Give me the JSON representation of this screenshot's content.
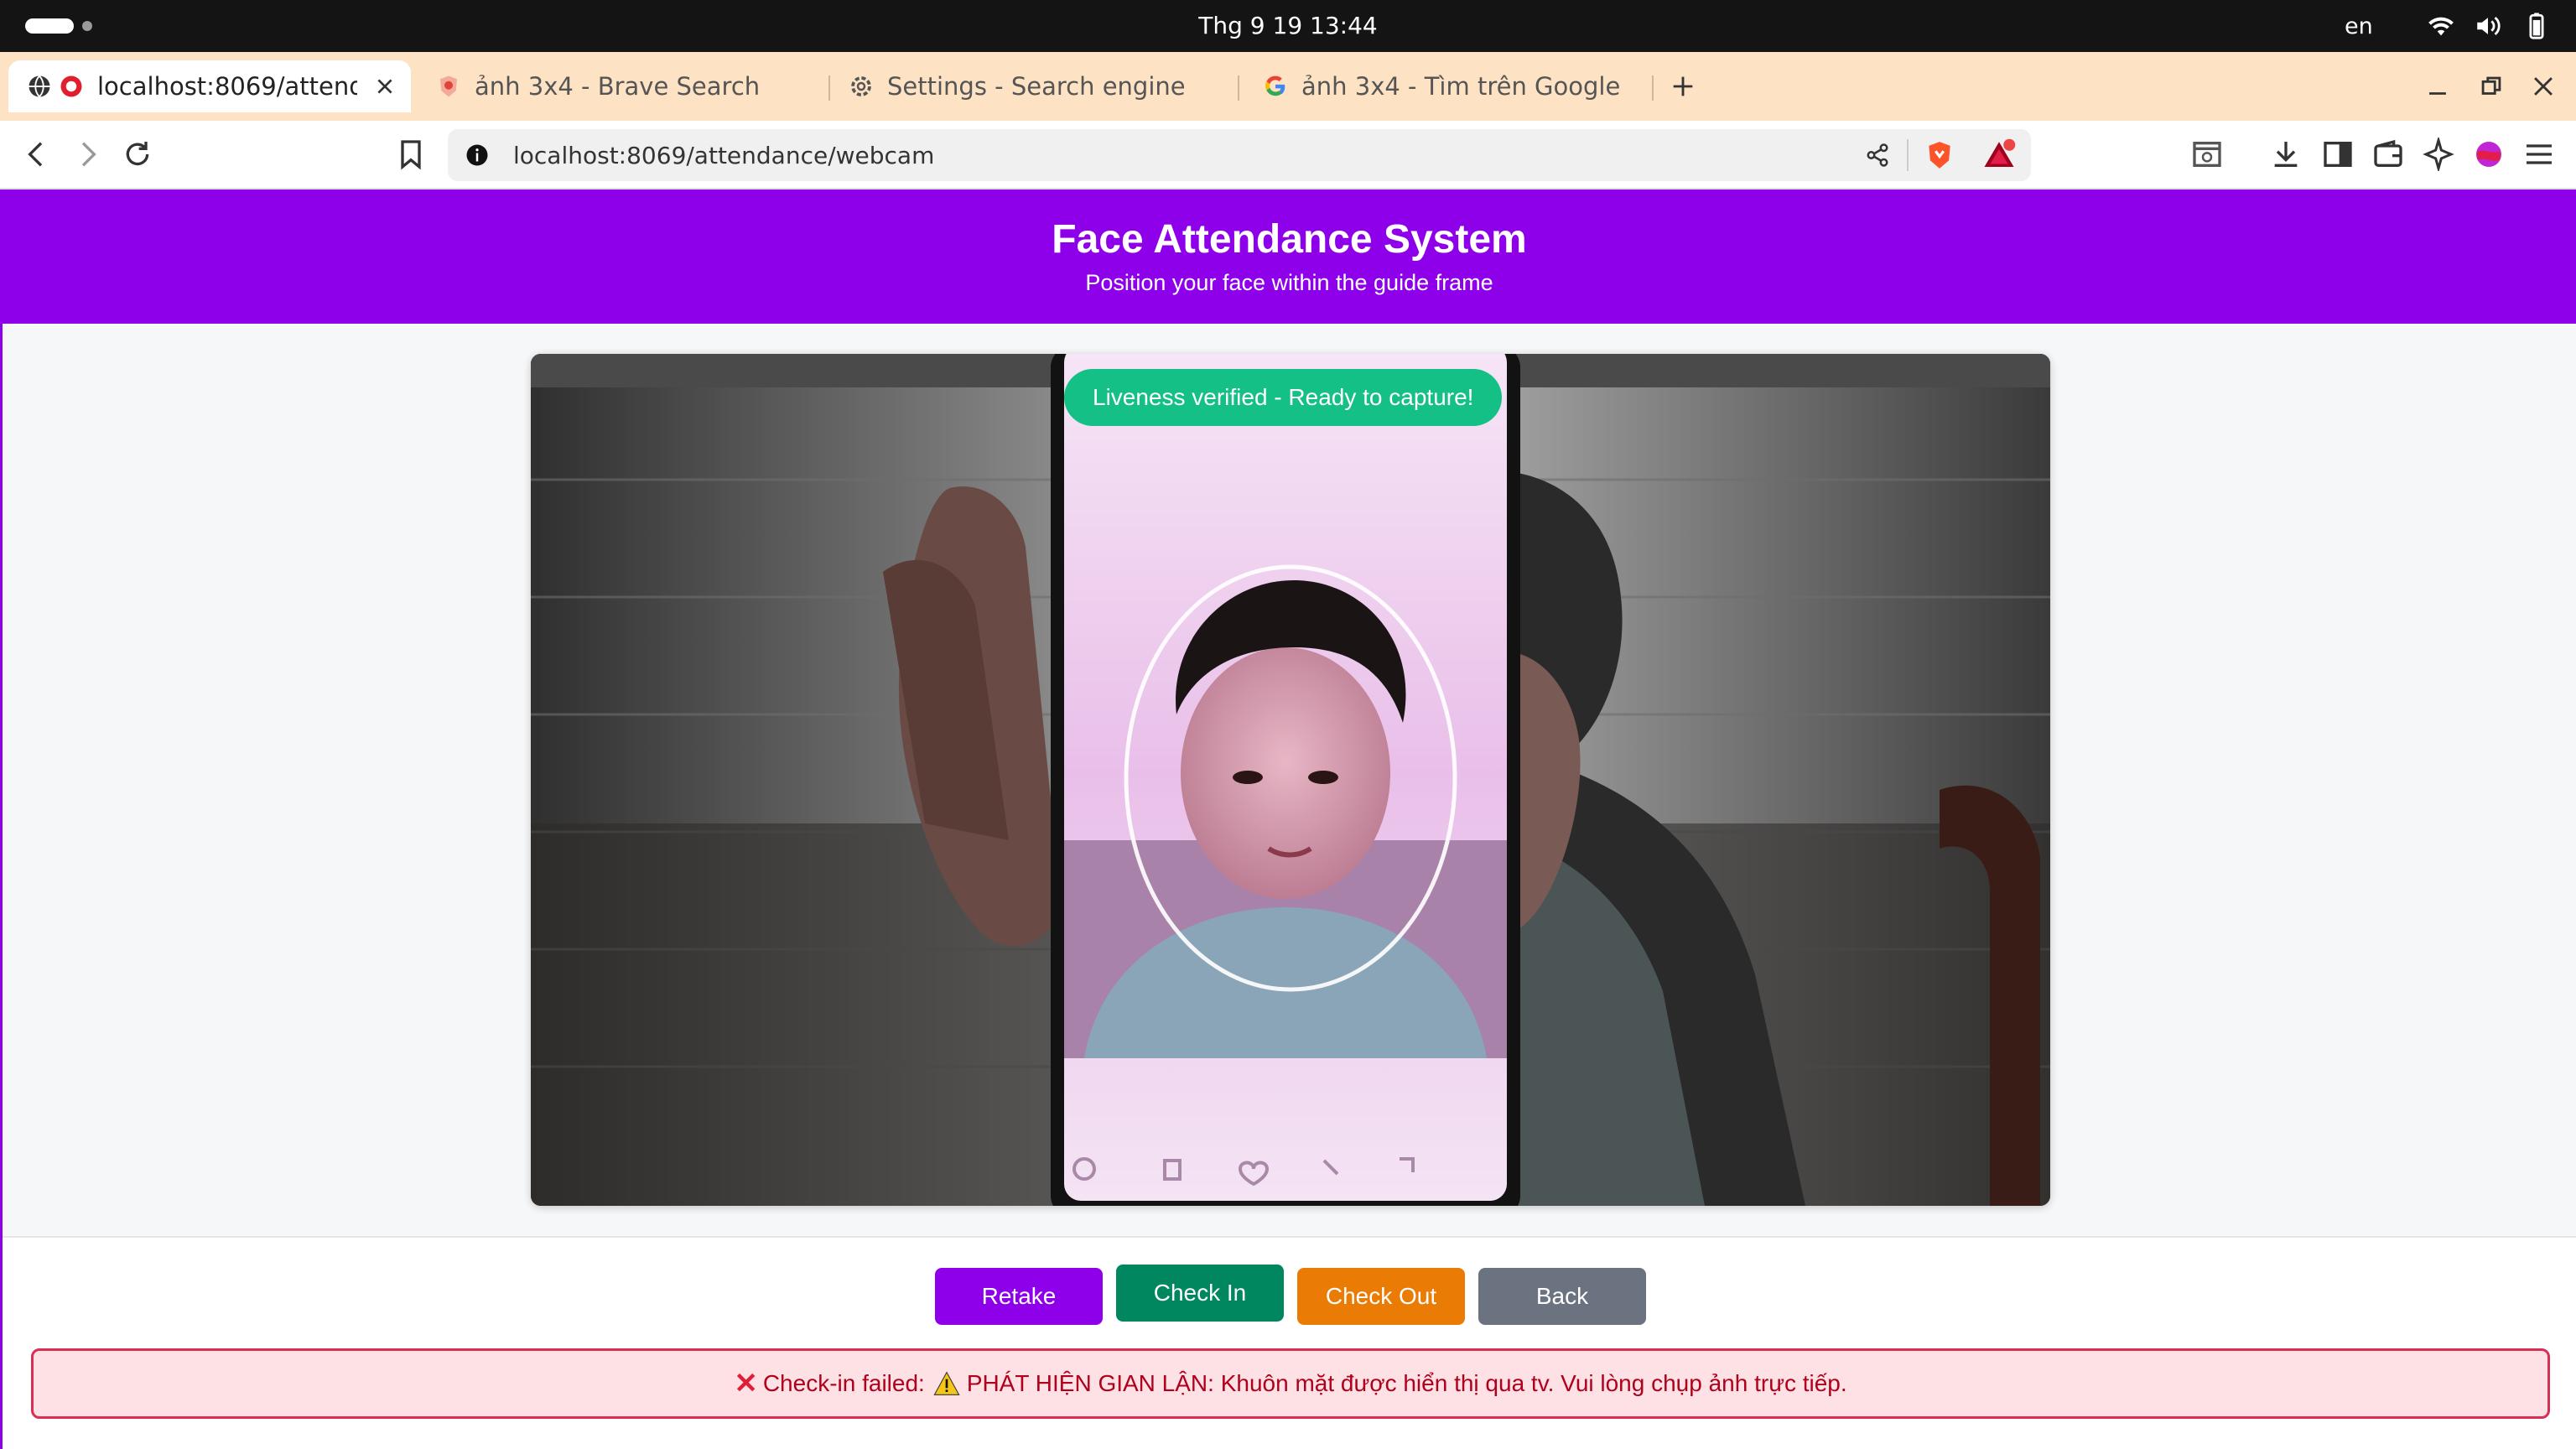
{
  "system": {
    "clock": "Thg 9 19  13:44",
    "lang": "en"
  },
  "tabs": [
    {
      "label": "localhost:8069/attendance/webcam",
      "icon": "globe-icon",
      "active": true
    },
    {
      "label": "ảnh 3x4 - Brave Search",
      "icon": "brave-icon"
    },
    {
      "label": "Settings - Search engine",
      "icon": "gear-icon"
    },
    {
      "label": "ảnh 3x4 - Tìm trên Google",
      "icon": "google-icon"
    }
  ],
  "address": {
    "url": "localhost:8069/attendance/webcam"
  },
  "app": {
    "title": "Face Attendance System",
    "subtitle": "Position your face within the guide frame",
    "liveness_status": "Liveness verified - Ready to capture!",
    "buttons": {
      "retake": "Retake",
      "check_in": "Check In",
      "check_out": "Check Out",
      "back": "Back"
    },
    "alert": {
      "prefix": "Check-in failed:",
      "message": "PHÁT HIỆN GIAN LẬN: Khuôn mặt được hiển thị qua tv. Vui lòng chụp ảnh trực tiếp."
    }
  },
  "colors": {
    "brand": "#8f00ea",
    "success": "#14c085",
    "checkin": "#008760",
    "checkout": "#ea7b04",
    "neutral": "#6b7280",
    "error": "#d92f55"
  }
}
